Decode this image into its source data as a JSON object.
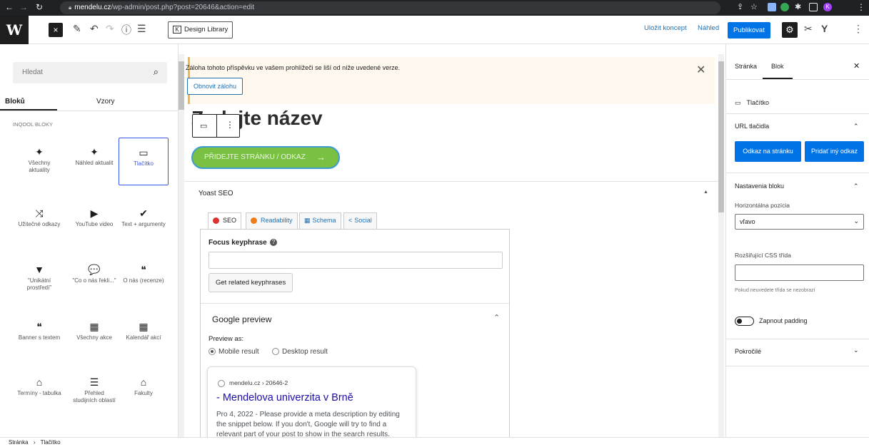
{
  "browser": {
    "url_domain": "mendelu.cz",
    "url_path": "/wp-admin/post.php?post=20646&action=edit"
  },
  "toolbar": {
    "wp_logo": "W",
    "close_label": "×",
    "design_library": "Design Library",
    "save_draft": "Uložit koncept",
    "preview": "Náhled",
    "publish": "Publikovat"
  },
  "inserter": {
    "search_placeholder": "Hledat",
    "tabs": [
      "Bloků",
      "Vzory"
    ],
    "category": "INQOOL BLOKY",
    "blocks": [
      {
        "label": "Všechny aktuality",
        "icon": "✦"
      },
      {
        "label": "Náhled aktualit",
        "icon": "✦"
      },
      {
        "label": "Tlačítko",
        "icon": "▭"
      },
      {
        "label": "Užitečné odkazy",
        "icon": "⤨"
      },
      {
        "label": "YouTube video",
        "icon": "▶"
      },
      {
        "label": "Text + argumenty",
        "icon": "✔"
      },
      {
        "label": "\"Unikátní prostředí\"",
        "icon": "▼"
      },
      {
        "label": "\"Co o nás řekli...\"",
        "icon": "💬"
      },
      {
        "label": "O nás (recenze)",
        "icon": "❝"
      },
      {
        "label": "Banner s textem",
        "icon": "❝"
      },
      {
        "label": "Všechny akce",
        "icon": "▦"
      },
      {
        "label": "Kalendář akcí",
        "icon": "▦"
      },
      {
        "label": "Termíny - tabulka",
        "icon": "⌂"
      },
      {
        "label": "Přehled studijních oblastí",
        "icon": "☰"
      },
      {
        "label": "Fakulty",
        "icon": "⌂"
      }
    ]
  },
  "editor": {
    "notice_text": "Záloha tohoto příspěvku ve vašem prohlížeči se liší od níže uvedené verze.",
    "notice_button": "Obnovit zálohu",
    "title_placeholder": "Zadejte název",
    "button_text": "PŘIDEJTE STRÁNKU / ODKAZ",
    "button_arrow": "→"
  },
  "yoast": {
    "title": "Yoast SEO",
    "tabs": [
      "SEO",
      "Readability",
      "Schema",
      "Social"
    ],
    "focus_label": "Focus keyphrase",
    "related_button": "Get related keyphrases",
    "google_preview": "Google preview",
    "preview_as": "Preview as:",
    "mobile": "Mobile result",
    "desktop": "Desktop result",
    "serp_url": "mendelu.cz › 20646-2",
    "serp_title": "- Mendelova univerzita v Brně",
    "serp_date": "Pro 4, 2022",
    "serp_desc": "Please provide a meta description by editing the snippet below. If you don't, Google will try to find a relevant part of your post to show in the search results."
  },
  "sidebar": {
    "tabs": [
      "Stránka",
      "Blok"
    ],
    "block_name": "Tlačítko",
    "url_section": "URL tlačidla",
    "link_page": "Odkaz na stránku",
    "link_other": "Pridať iný odkaz",
    "settings_section": "Nastavenia bloku",
    "h_position_label": "Horizontálna pozícia",
    "h_position_value": "vľavo",
    "css_label": "Rozšiřující CSS třída",
    "css_help": "Pokud neuvedete třída se nezobrazí",
    "padding_label": "Zapnout padding",
    "advanced": "Pokročilé"
  },
  "footer": {
    "crumb1": "Stránka",
    "sep": "›",
    "crumb2": "Tlačítko"
  },
  "colors": {
    "accent": "#0073e6",
    "selected_block": "#3858e9",
    "button_green": "#7ac143",
    "notice_border": "#f0b849"
  }
}
